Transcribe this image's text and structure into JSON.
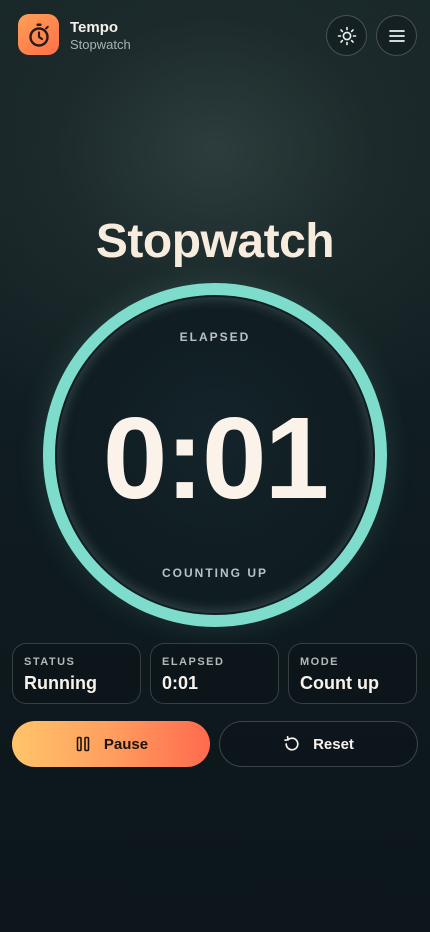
{
  "header": {
    "app_name": "Tempo",
    "app_subtitle": "Stopwatch",
    "app_icon": "stopwatch-icon",
    "theme_icon": "sun-icon",
    "menu_icon": "menu-icon"
  },
  "title": "Stopwatch",
  "dial": {
    "top_label": "ELAPSED",
    "time": "0:01",
    "bottom_label": "COUNTING UP",
    "ring_color": "#7ddccc"
  },
  "stats": [
    {
      "label": "STATUS",
      "value": "Running"
    },
    {
      "label": "ELAPSED",
      "value": "0:01"
    },
    {
      "label": "MODE",
      "value": "Count up"
    }
  ],
  "actions": {
    "pause_label": "Pause",
    "pause_icon": "pause-icon",
    "reset_label": "Reset",
    "reset_icon": "reset-icon"
  },
  "colors": {
    "accent_start": "#ffc46a",
    "accent_end": "#ff6a4e",
    "ring": "#7ddccc"
  }
}
